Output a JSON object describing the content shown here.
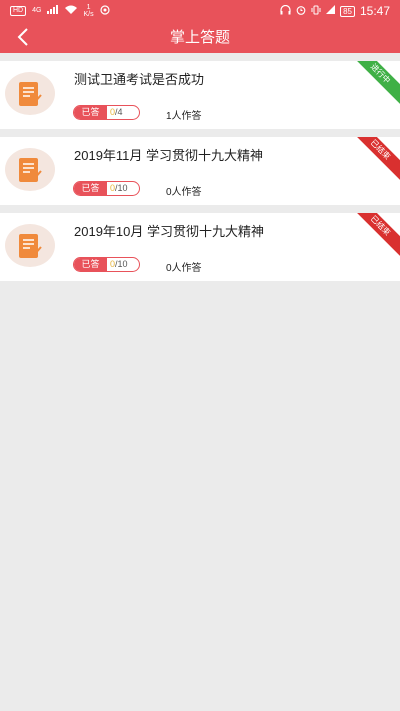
{
  "status_bar": {
    "hd": "HD",
    "signal": "4G",
    "speed_value": "1",
    "speed_unit": "K/s",
    "battery": "85",
    "time": "15:47"
  },
  "nav": {
    "title": "掌上答题"
  },
  "quizzes": [
    {
      "title": "测试卫通考试是否成功",
      "done_label": "已答",
      "answered": "0",
      "total": "/4",
      "participants": "1人作答",
      "status": "进行中",
      "status_color": "#3fb046"
    },
    {
      "title": "2019年11月 学习贯彻十九大精神",
      "done_label": "已答",
      "answered": "0",
      "total": "/10",
      "participants": "0人作答",
      "status": "已结束",
      "status_color": "#d9302f"
    },
    {
      "title": "2019年10月 学习贯彻十九大精神",
      "done_label": "已答",
      "answered": "0",
      "total": "/10",
      "participants": "0人作答",
      "status": "已结束",
      "status_color": "#d9302f"
    }
  ],
  "colors": {
    "primary": "#e8525a",
    "background": "#ebebeb",
    "icon_orange": "#f08a3c"
  }
}
